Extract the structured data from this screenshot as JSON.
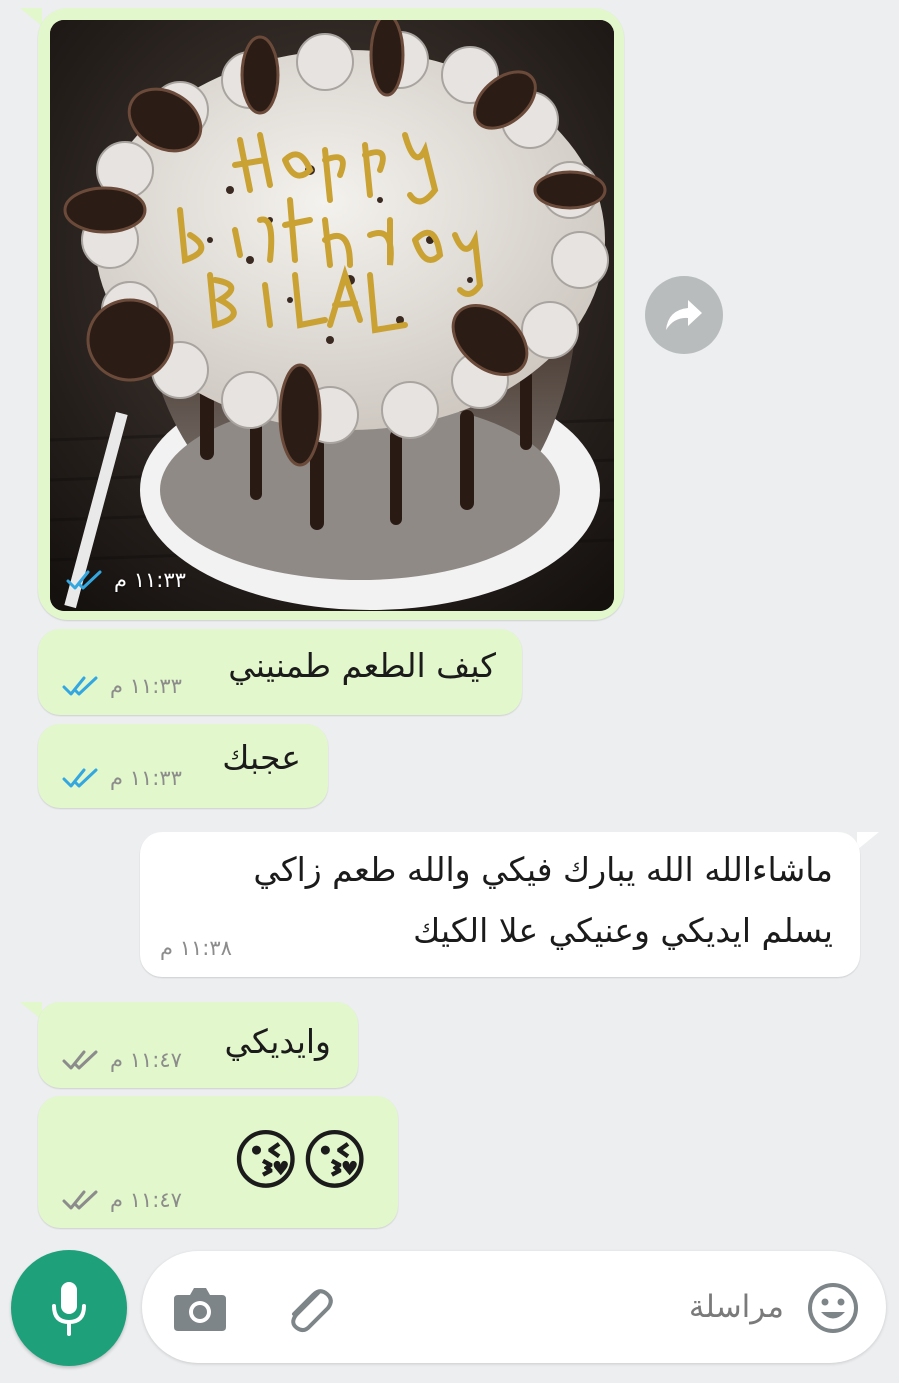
{
  "chat": {
    "image_message": {
      "photo_description_text": "HAPPY birthday BILAL",
      "time": "١١:٣٣ م",
      "status": "read"
    },
    "messages": [
      {
        "direction": "out",
        "text": "كيف الطعم طمنيني",
        "time": "١١:٣٣ م",
        "status": "read"
      },
      {
        "direction": "out",
        "text": "عجبك",
        "time": "١١:٣٣ م",
        "status": "read"
      },
      {
        "direction": "in",
        "lines": [
          "ماشاءالله الله يبارك فيكي والله طعم زاكي",
          "يسلم ايديكي وعنيكي علا الكيك"
        ],
        "time": "١١:٣٨ م"
      },
      {
        "direction": "out",
        "text": "وايديكي",
        "time": "١١:٤٧ م",
        "status": "delivered"
      },
      {
        "direction": "out",
        "text": "😘😘",
        "time": "١١:٤٧ م",
        "status": "delivered"
      }
    ]
  },
  "input": {
    "placeholder": "مراسلة"
  },
  "icons": {
    "forward": "forward-icon",
    "mic": "microphone-icon",
    "camera": "camera-icon",
    "attach": "paperclip-icon",
    "emoji": "smiley-icon"
  },
  "colors": {
    "outgoing_bubble": "#e2f7cb",
    "incoming_bubble": "#ffffff",
    "read_tick": "#34a7e0",
    "delivered_tick": "#8c8c8c",
    "mic_button": "#1ea07b"
  }
}
